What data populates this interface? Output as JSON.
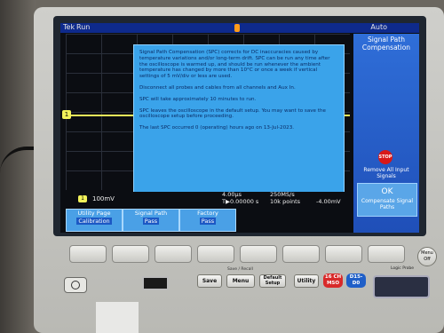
{
  "topbar": {
    "brand": "Tek",
    "run_state": "Run",
    "trigger_mode": "Auto"
  },
  "sidepanel": {
    "title": "Signal Path Compensation",
    "remove_label": "Remove All Input Signals",
    "stop_icon_text": "STOP",
    "ok_label": "OK",
    "compensate_label": "Compensate Signal Paths"
  },
  "dialog": {
    "paragraphs": [
      "Signal Path Compensation (SPC) corrects for DC inaccuracies caused by temperature variations and/or long-term drift. SPC can be run any time after the oscilloscope is warmed up, and should be run whenever the ambient temperature has changed by more than 10°C or once a week if vertical settings of 5 mV/div or less are used.",
      "Disconnect all probes and cables from all channels and Aux In.",
      "SPC will take approximately 10 minutes to run.",
      "SPC leaves the oscilloscope in the default setup. You may want to save the oscilloscope setup before proceeding.",
      "The last SPC occurred 0 (operating) hours ago on 13-Jul-2023."
    ]
  },
  "readout": {
    "ch1_label": "1",
    "ch1_scale": "100mV",
    "timebase": "4.00µs",
    "sample_rate": "250MS/s",
    "trigger_pos": "T▶0.00000 s",
    "record_points": "10k points",
    "trigger_level": "-4.00mV"
  },
  "bottom_menu": [
    {
      "title": "Utility Page",
      "value": "Calibration"
    },
    {
      "title": "Signal Path",
      "value": "Pass"
    },
    {
      "title": "Factory",
      "value": "Pass"
    }
  ],
  "hardware": {
    "save_recall_label": "Save / Recall",
    "save": "Save",
    "menu": "Menu",
    "default_setup": "Default Setup",
    "utility": "Utility",
    "msop_label": "16 CH MSO",
    "d15_label": "D15-D0",
    "menu_off_label": "Menu Off",
    "logic_probe_label": "Logic Probe"
  },
  "colors": {
    "trace": "#f2f25a",
    "dialog": "#3aa3ea",
    "topbar": "#0e2a8c",
    "stop": "#d81818"
  }
}
